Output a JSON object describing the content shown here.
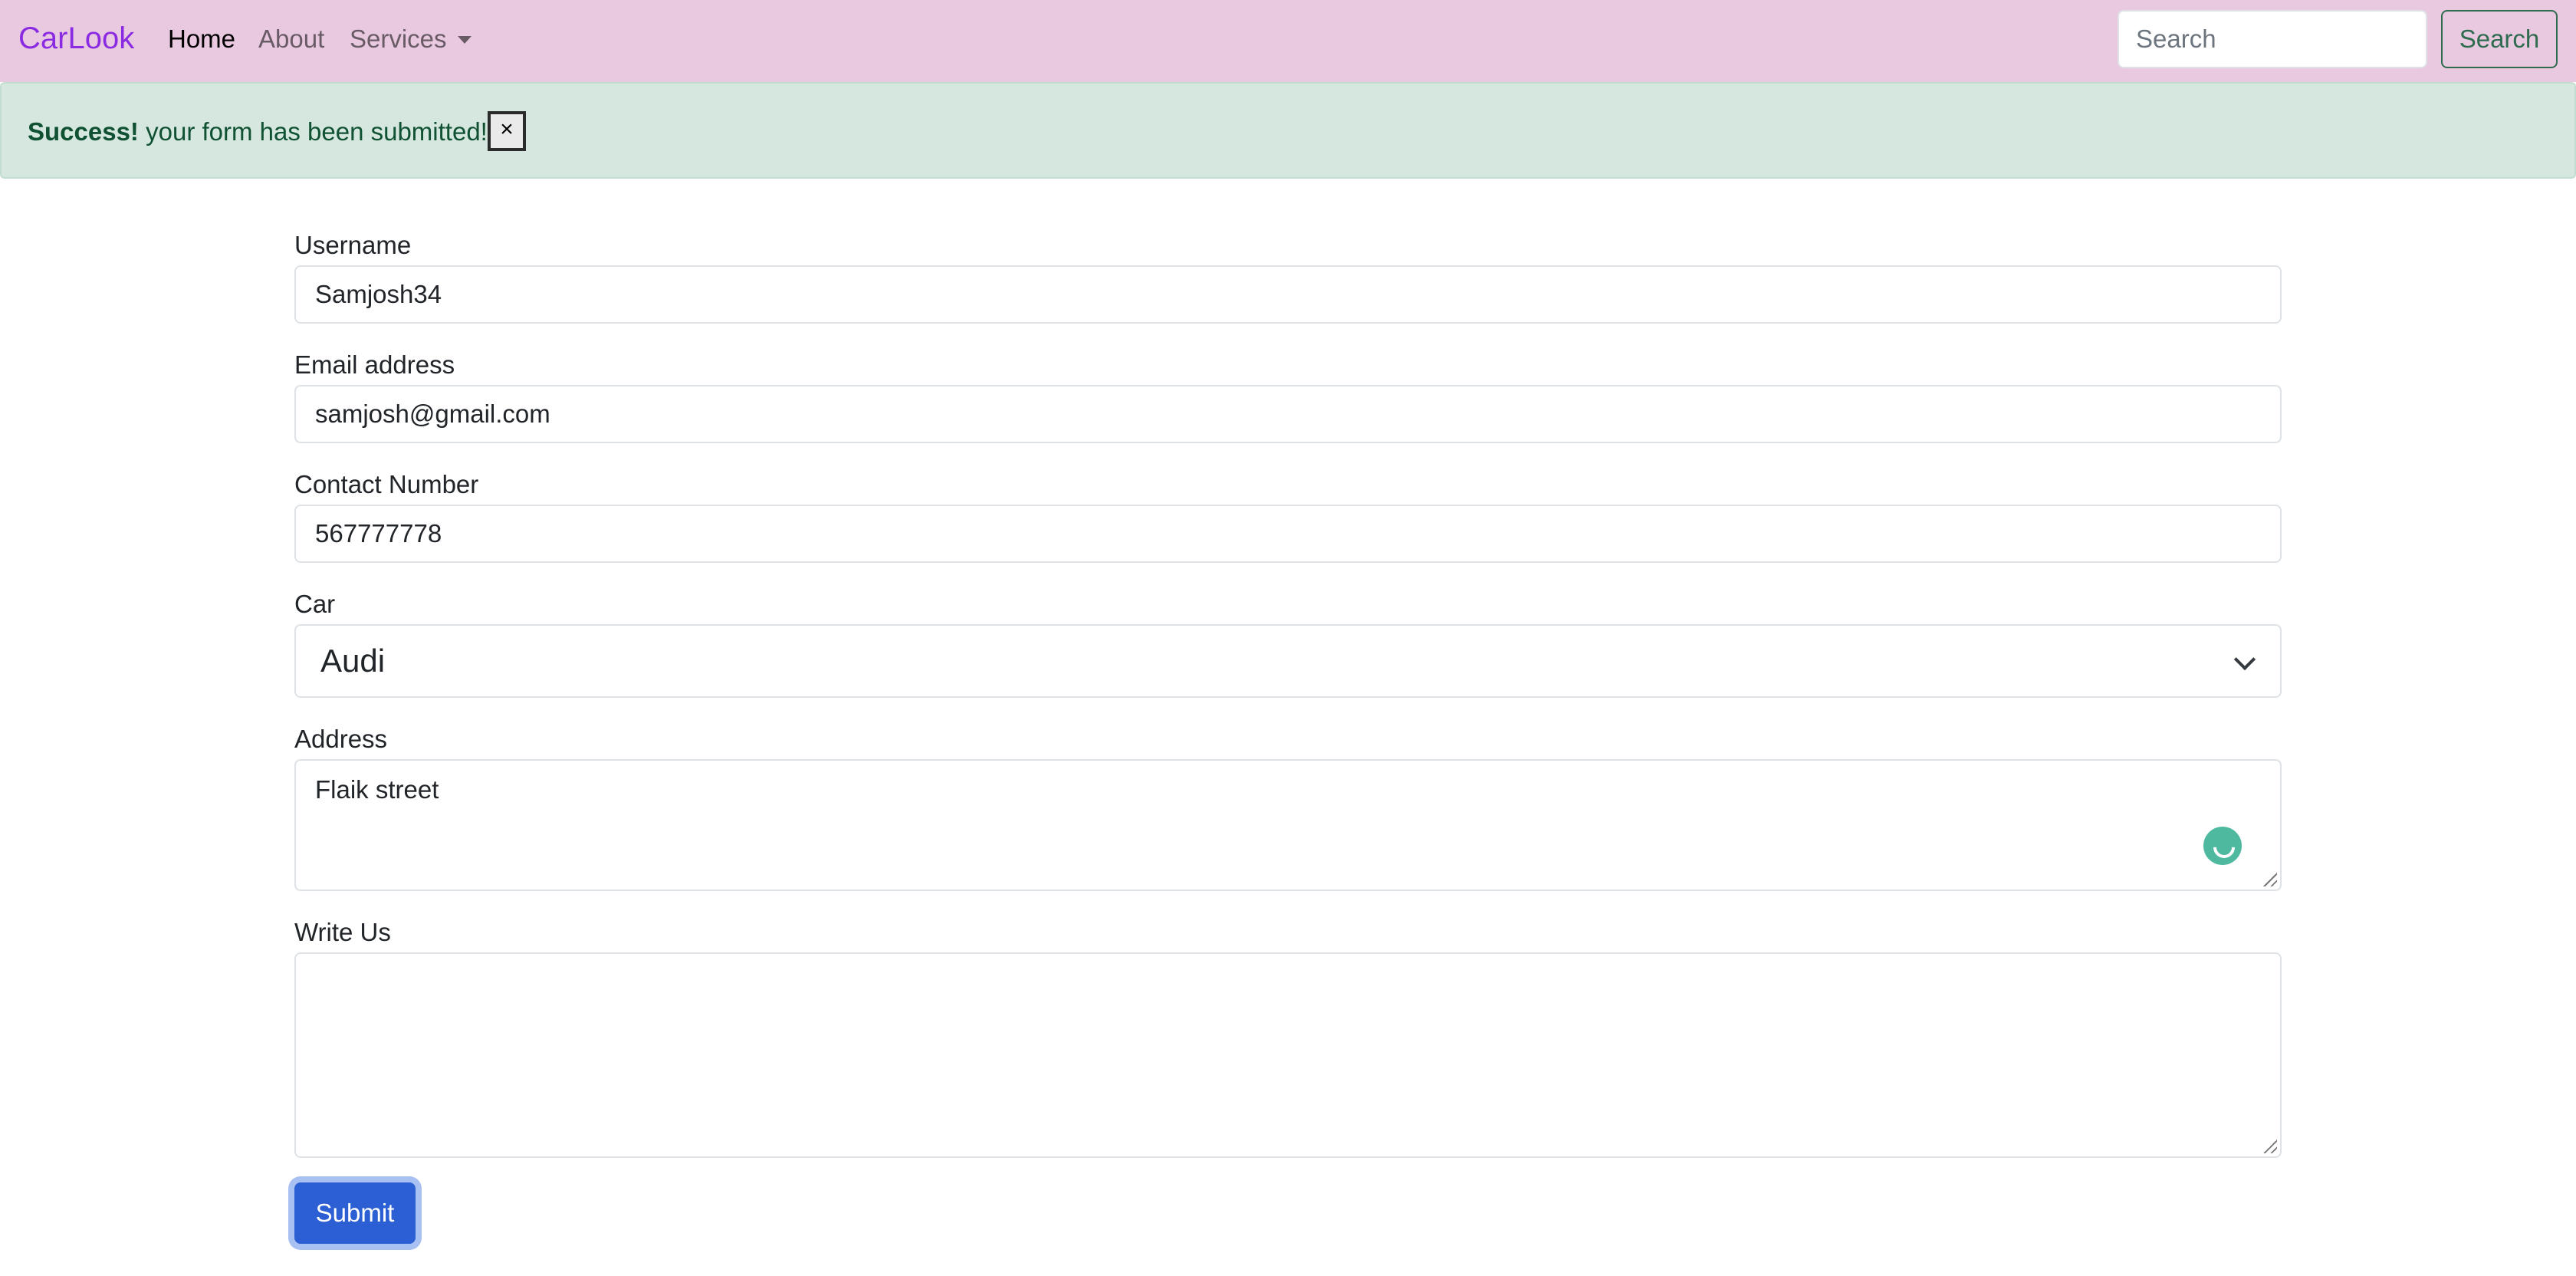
{
  "navbar": {
    "brand": "CarLook",
    "links": [
      "Home",
      "About",
      "Services"
    ],
    "search_placeholder": "Search",
    "search_button": "Search"
  },
  "alert": {
    "strong": "Success!",
    "message": "your form has been submitted!",
    "close_label": "×"
  },
  "form": {
    "username": {
      "label": "Username",
      "value": "Samjosh34"
    },
    "email": {
      "label": "Email address",
      "value": "samjosh@gmail.com"
    },
    "contact": {
      "label": "Contact Number",
      "value": "567777778"
    },
    "car": {
      "label": "Car",
      "value": "Audi"
    },
    "address": {
      "label": "Address",
      "value": "Flaik street"
    },
    "write_us": {
      "label": "Write Us",
      "value": ""
    },
    "submit_label": "Submit"
  },
  "colors": {
    "navbar_bg": "#e9c9e0",
    "brand": "#8a2be2",
    "alert_bg": "#d5e7de",
    "primary": "#2b5fd3"
  }
}
